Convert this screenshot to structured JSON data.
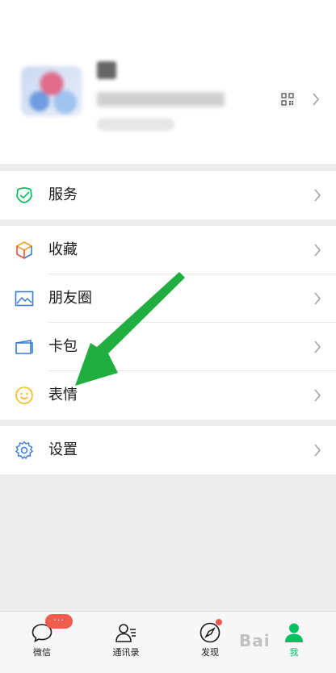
{
  "menu": {
    "groups": [
      [
        {
          "label": "服务",
          "icon": "service-icon"
        }
      ],
      [
        {
          "label": "收藏",
          "icon": "favorites-cube-icon"
        },
        {
          "label": "朋友圈",
          "icon": "moments-image-icon"
        },
        {
          "label": "卡包",
          "icon": "card-wallet-icon"
        },
        {
          "label": "表情",
          "icon": "sticker-smiley-icon"
        }
      ],
      [
        {
          "label": "设置",
          "icon": "settings-gear-icon"
        }
      ]
    ]
  },
  "tabbar": {
    "items": [
      {
        "label": "微信",
        "icon": "chat-bubble-icon",
        "badge": "···"
      },
      {
        "label": "通讯录",
        "icon": "contacts-icon"
      },
      {
        "label": "发现",
        "icon": "discover-compass-icon"
      },
      {
        "label": "我",
        "icon": "me-person-icon",
        "active": true
      }
    ]
  },
  "watermark": "Bai",
  "colors": {
    "accent_green": "#07c160",
    "arrow_green": "#1fae3f",
    "badge_red": "#f25c4f",
    "background": "#ededed"
  }
}
